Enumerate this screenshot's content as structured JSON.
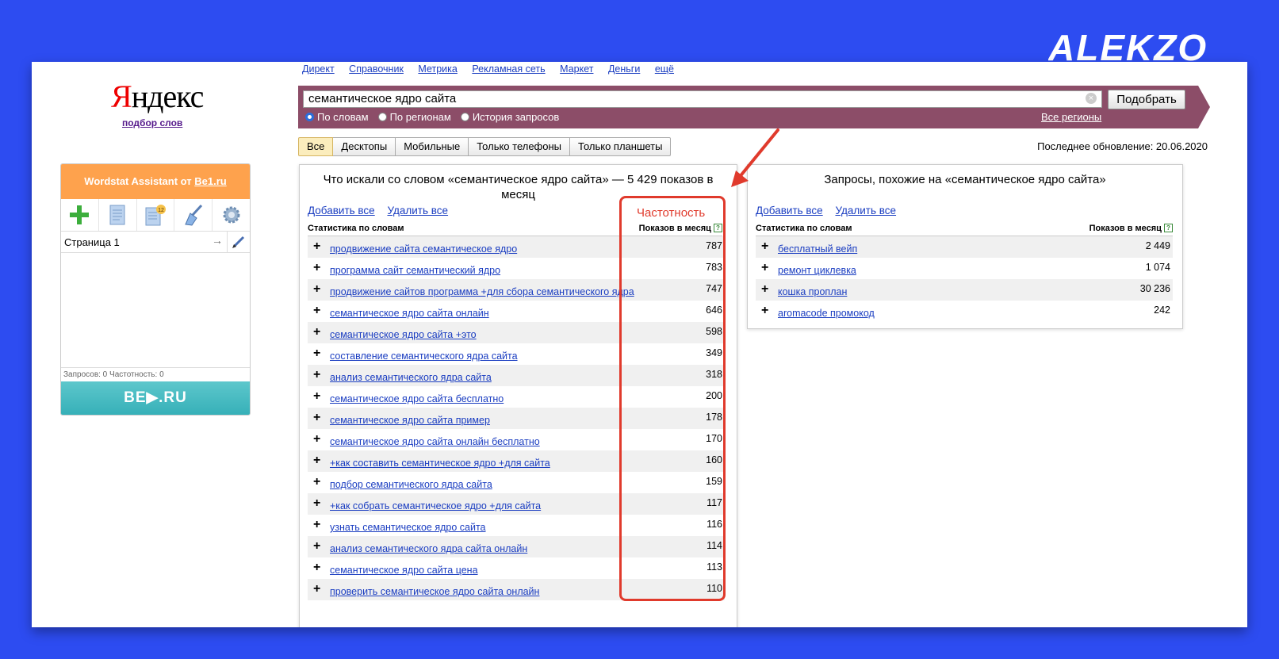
{
  "brand": {
    "logo_text": "ALEKZO"
  },
  "yandex": {
    "logo_first": "Я",
    "logo_rest": "ндекс",
    "subtitle": "подбор слов"
  },
  "topnav": [
    "Директ",
    "Справочник",
    "Метрика",
    "Рекламная сеть",
    "Маркет",
    "Деньги",
    "ещё"
  ],
  "search": {
    "value": "семантическое ядро сайта",
    "clear_symbol": "×",
    "button": "Подобрать",
    "radios": [
      {
        "label": "По словам",
        "checked": true
      },
      {
        "label": "По регионам",
        "checked": false
      },
      {
        "label": "История запросов",
        "checked": false
      }
    ],
    "all_regions": "Все регионы",
    "bar_color": "#8c4d68"
  },
  "tabs": [
    {
      "label": "Все",
      "active": true
    },
    {
      "label": "Десктопы",
      "active": false
    },
    {
      "label": "Мобильные",
      "active": false
    },
    {
      "label": "Только телефоны",
      "active": false
    },
    {
      "label": "Только планшеты",
      "active": false
    }
  ],
  "last_update": "Последнее обновление: 20.06.2020",
  "assistant": {
    "title_prefix": "Wordstat Assistant от ",
    "title_link": "Be1.ru",
    "badge_count": "12",
    "page_label": "Страница 1",
    "arrow_symbol": "→",
    "stats": "Запросов: 0  Частотность: 0",
    "footer_logo": "BE▶.RU",
    "header_color": "#fea24d",
    "footer_color": "#3cb4bb"
  },
  "left_panel": {
    "title": "Что искали со словом «семантическое ядро сайта» — 5 429 показов в месяц",
    "add_all": "Добавить все",
    "remove_all": "Удалить все",
    "col1": "Статистика по словам",
    "col2": "Показов в месяц",
    "col2_help": "?",
    "rows": [
      {
        "kw": "продвижение сайта семантическое ядро",
        "count": "787"
      },
      {
        "kw": "программа сайт семантический ядро",
        "count": "783"
      },
      {
        "kw": "продвижение сайтов программа +для сбора семантического ядра",
        "count": "747"
      },
      {
        "kw": "семантическое ядро сайта онлайн",
        "count": "646"
      },
      {
        "kw": "семантическое ядро сайта +это",
        "count": "598"
      },
      {
        "kw": "составление семантического ядра сайта",
        "count": "349"
      },
      {
        "kw": "анализ семантического ядра сайта",
        "count": "318"
      },
      {
        "kw": "семантическое ядро сайта бесплатно",
        "count": "200"
      },
      {
        "kw": "семантическое ядро сайта пример",
        "count": "178"
      },
      {
        "kw": "семантическое ядро сайта онлайн бесплатно",
        "count": "170"
      },
      {
        "kw": "+как составить семантическое ядро +для сайта",
        "count": "160"
      },
      {
        "kw": "подбор семантического ядра сайта",
        "count": "159"
      },
      {
        "kw": "+как собрать семантическое ядро +для сайта",
        "count": "117"
      },
      {
        "kw": "узнать семантическое ядро сайта",
        "count": "116"
      },
      {
        "kw": "анализ семантического ядра сайта онлайн",
        "count": "114"
      },
      {
        "kw": "семантическое ядро сайта цена",
        "count": "113"
      },
      {
        "kw": "проверить семантическое ядро сайта онлайн",
        "count": "110"
      }
    ]
  },
  "right_panel": {
    "title": "Запросы, похожие на «семантическое ядро сайта»",
    "add_all": "Добавить все",
    "remove_all": "Удалить все",
    "col1": "Статистика по словам",
    "col2": "Показов в месяц",
    "col2_help": "?",
    "rows": [
      {
        "kw": "бесплатный вейп",
        "count": "2 449"
      },
      {
        "kw": "ремонт циклевка",
        "count": "1 074"
      },
      {
        "kw": "кошка проплан",
        "count": "30 236"
      },
      {
        "kw": "aromacode промокод",
        "count": "242"
      }
    ]
  },
  "annotation": {
    "label": "Частотность",
    "color": "#e03a2c"
  },
  "plus_symbol": "+"
}
